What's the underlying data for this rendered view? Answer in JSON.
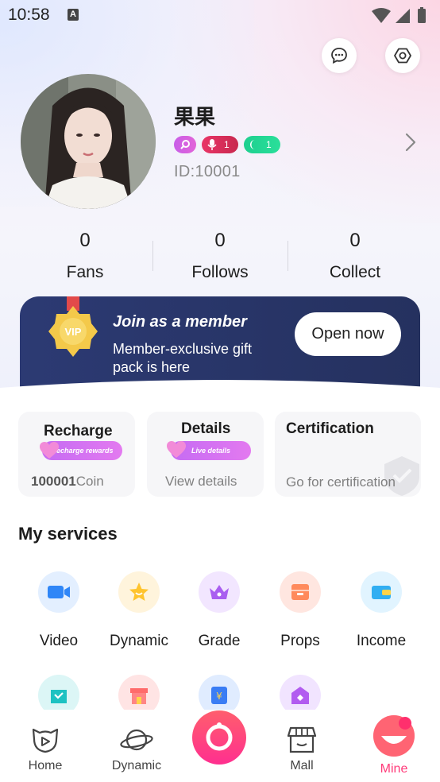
{
  "status_bar": {
    "time": "10:58",
    "a_icon": "A"
  },
  "profile": {
    "name": "果果",
    "id": "ID:10001",
    "badges": [
      {
        "icon": "search-badge-icon",
        "value": ""
      },
      {
        "icon": "mic-badge-icon",
        "value": "1"
      },
      {
        "icon": "moon-badge-icon",
        "value": "1"
      }
    ]
  },
  "stats": [
    {
      "value": "0",
      "label": "Fans"
    },
    {
      "value": "0",
      "label": "Follows"
    },
    {
      "value": "0",
      "label": "Collect"
    }
  ],
  "member": {
    "badge": "VIP",
    "title": "Join as a member",
    "subtitle": "Member-exclusive gift pack is here",
    "button": "Open now"
  },
  "cards": {
    "recharge": {
      "title": "Recharge",
      "pill": "Recharge rewards",
      "amount": "100001",
      "unit": "Coin"
    },
    "details": {
      "title": "Details",
      "pill": "Live details",
      "sub": "View details"
    },
    "certification": {
      "title": "Certification",
      "sub": "Go for certification"
    }
  },
  "services": {
    "title": "My services",
    "items": [
      {
        "label": "Video",
        "icon": "video-icon"
      },
      {
        "label": "Dynamic",
        "icon": "star-icon"
      },
      {
        "label": "Grade",
        "icon": "crown-icon"
      },
      {
        "label": "Props",
        "icon": "box-icon"
      },
      {
        "label": "Income",
        "icon": "wallet-icon"
      }
    ],
    "row2_icons": [
      "bag-icon",
      "store-icon",
      "ticket-icon",
      "home-icon"
    ]
  },
  "nav": [
    {
      "label": "Home",
      "active": false
    },
    {
      "label": "Dynamic",
      "active": false
    },
    {
      "label": "",
      "active": false
    },
    {
      "label": "Mall",
      "active": false
    },
    {
      "label": "Mine",
      "active": true
    }
  ],
  "colors": {
    "active": "#ff3b7a",
    "pill": "#d06ff2",
    "banner": "#27345f"
  }
}
